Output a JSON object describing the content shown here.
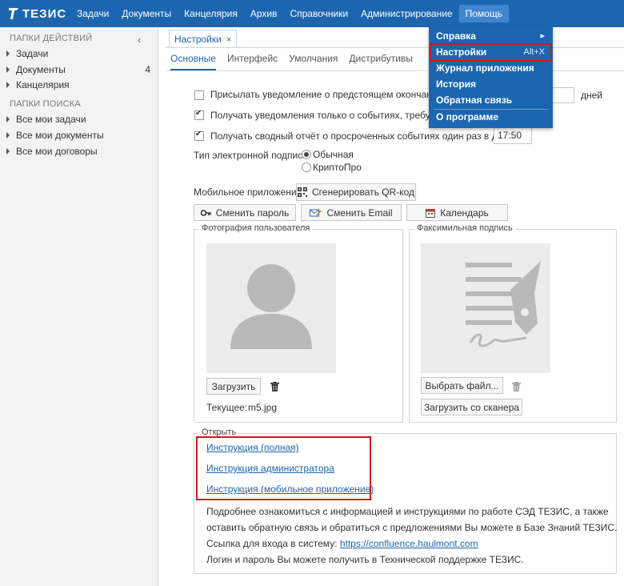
{
  "app": {
    "logo_text": "ТЕЗИС"
  },
  "topmenu": [
    "Задачи",
    "Документы",
    "Канцелярия",
    "Архив",
    "Справочники",
    "Администрирование",
    "Помощь"
  ],
  "sidebar": {
    "collapse_icon": "‹",
    "actions_header": "ПАПКИ ДЕЙСТВИЙ",
    "actions": [
      {
        "label": "Задачи",
        "count": ""
      },
      {
        "label": "Документы",
        "count": "4"
      },
      {
        "label": "Канцелярия",
        "count": ""
      }
    ],
    "search_header": "ПАПКИ ПОИСКА",
    "search": [
      {
        "label": "Все мои задачи"
      },
      {
        "label": "Все мои документы"
      },
      {
        "label": "Все мои договоры"
      }
    ]
  },
  "tab": {
    "label": "Настройки",
    "close": "×"
  },
  "subtabs": [
    "Основные",
    "Интерфейс",
    "Умолчания",
    "Дистрибутивы"
  ],
  "settings": {
    "notify_expiry": "Присылать уведомление о предстоящем окончании об",
    "days_label": "дней",
    "notify_only": "Получать уведомления только о событиях, требующих",
    "digest": "Получать сводный отчёт о просроченных событиях один раз в день в",
    "digest_time": "17:50",
    "sign_type_label": "Тип электронной подписи",
    "sign_options": [
      "Обычная",
      "КриптоПро"
    ],
    "mobile_label": "Мобильное приложение",
    "qr_button": "Сгенерировать QR-код",
    "change_password": "Сменить пароль",
    "change_email": "Сменить Email",
    "calendar": "Календарь"
  },
  "photo": {
    "legend": "Фотография пользователя",
    "upload": "Загрузить",
    "current_label": "Текущее:",
    "current_file": "m5.jpg"
  },
  "facsimile": {
    "legend": "Факсимильная подпись",
    "choose_file": "Выбрать файл...",
    "scan": "Загрузить со сканера"
  },
  "open": {
    "legend": "Открыть",
    "links": [
      "Инструкция (полная)",
      "Инструкция администратора",
      "Инструкция (мобильное приложение)"
    ],
    "info1": "Подробнее ознакомиться с информацией и инструкциями по работе СЭД ТЕЗИС, а также",
    "info2": "оставить обратную связь и обратиться с предложениями Вы можете в Базе Знаний ТЕЗИС.",
    "info3_prefix": "Ссылка для входа в систему:",
    "info3_link": "https://confluence.haulmont.com",
    "info4": "Логин и пароль Вы можете получить в Технической поддержке ТЕЗИС."
  },
  "help_menu": {
    "items": [
      {
        "label": "Справка",
        "shortcut": "▸"
      },
      {
        "label": "Настройки",
        "shortcut": "Alt+X"
      },
      {
        "label": "Журнал приложения",
        "shortcut": ""
      },
      {
        "label": "История",
        "shortcut": ""
      },
      {
        "label": "Обратная связь",
        "shortcut": ""
      },
      {
        "label": "О программе",
        "shortcut": ""
      }
    ]
  },
  "colors": {
    "brand": "#1c66b0",
    "highlight": "#e0111a"
  }
}
